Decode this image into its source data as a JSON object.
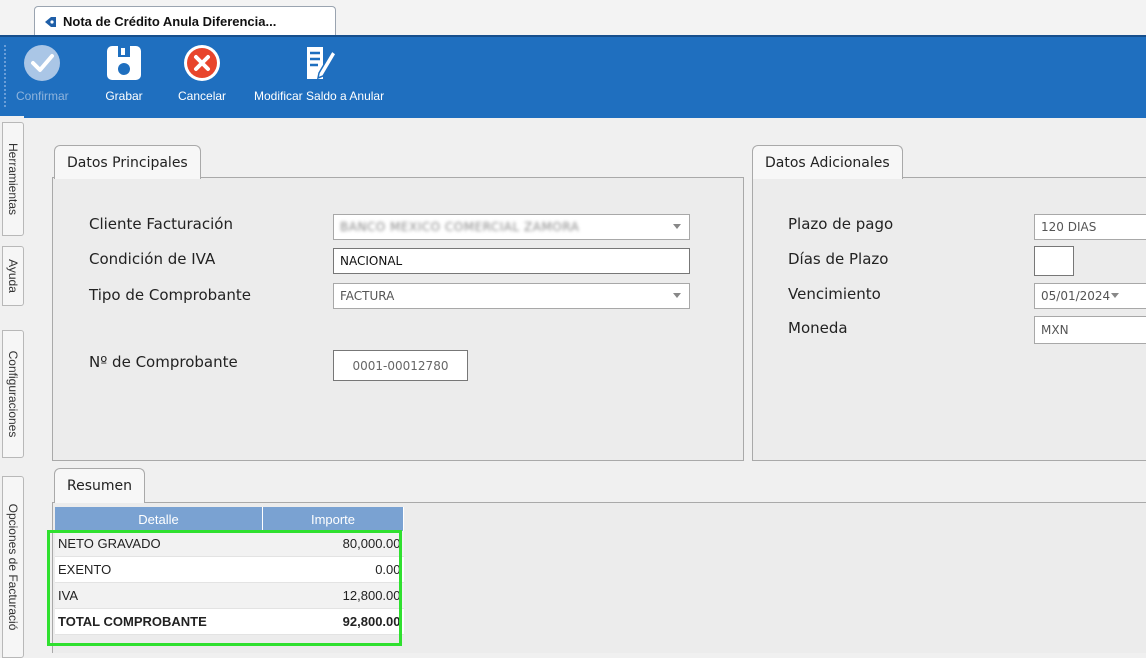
{
  "document_tab": {
    "title": "Nota de Crédito Anula Diferencia..."
  },
  "toolbar": {
    "confirm_label": "Confirmar",
    "save_label": "Grabar",
    "cancel_label": "Cancelar",
    "modify_label": "Modificar Saldo a Anular"
  },
  "side_tabs": [
    "Herramientas",
    "Ayuda",
    "Configuraciones",
    "Opciones de Facturació"
  ],
  "datos_principales": {
    "tab_label": "Datos Principales",
    "cliente_label": "Cliente Facturación",
    "cliente_value": "BANCO MEXICO COMERCIAL ZAMORA",
    "iva_label": "Condición de IVA",
    "iva_value": "NACIONAL",
    "tipo_label": "Tipo de Comprobante",
    "tipo_value": "FACTURA",
    "nro_label": "Nº de Comprobante",
    "nro_value": "0001-00012780"
  },
  "datos_adicionales": {
    "tab_label": "Datos Adicionales",
    "plazo_label": "Plazo de pago",
    "plazo_value": "120 DIAS",
    "dias_label": "Días de Plazo",
    "dias_value": "",
    "venc_label": "Vencimiento",
    "venc_value": "05/01/2024",
    "moneda_label": "Moneda",
    "moneda_value": "MXN"
  },
  "resumen": {
    "tab_label": "Resumen",
    "headers": [
      "Detalle",
      "Importe"
    ],
    "rows": [
      {
        "detalle": "NETO GRAVADO",
        "importe": "80,000.00"
      },
      {
        "detalle": "EXENTO",
        "importe": "0.00"
      },
      {
        "detalle": "IVA",
        "importe": "12,800.00"
      },
      {
        "detalle": "TOTAL COMPROBANTE",
        "importe": "92,800.00"
      }
    ]
  },
  "colors": {
    "ribbon": "#1f6fbf",
    "table_header": "#7aa2d2",
    "highlight": "#2fe02f"
  }
}
